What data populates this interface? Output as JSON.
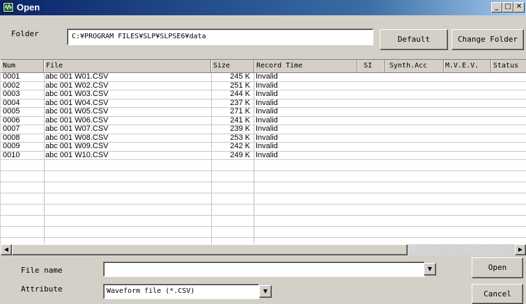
{
  "window": {
    "title": "Open",
    "minimize_label": "_",
    "maximize_label": "□",
    "close_label": "✕"
  },
  "folder": {
    "label": "Folder",
    "path": "C:¥PROGRAM FILES¥SLP¥SLPSE6¥data",
    "default_label": "Default",
    "change_folder_label": "Change Folder"
  },
  "table": {
    "columns": [
      "Num",
      "File",
      "Size",
      "Record Time",
      "SI",
      "Synth.Acc",
      "M.V.E.V.",
      "Status"
    ],
    "rows": [
      {
        "num": "0001",
        "file": "abc 001  W01.CSV",
        "size": "245 K",
        "record_time": "Invalid"
      },
      {
        "num": "0002",
        "file": "abc 001  W02.CSV",
        "size": "251 K",
        "record_time": "Invalid"
      },
      {
        "num": "0003",
        "file": "abc 001  W03.CSV",
        "size": "244 K",
        "record_time": "Invalid"
      },
      {
        "num": "0004",
        "file": "abc 001  W04.CSV",
        "size": "237 K",
        "record_time": "Invalid"
      },
      {
        "num": "0005",
        "file": "abc 001  W05.CSV",
        "size": "271 K",
        "record_time": "Invalid"
      },
      {
        "num": "0006",
        "file": "abc 001  W06.CSV",
        "size": "241 K",
        "record_time": "Invalid"
      },
      {
        "num": "0007",
        "file": "abc 001  W07.CSV",
        "size": "239 K",
        "record_time": "Invalid"
      },
      {
        "num": "0008",
        "file": "abc 001  W08.CSV",
        "size": "253 K",
        "record_time": "Invalid"
      },
      {
        "num": "0009",
        "file": "abc 001  W09.CSV",
        "size": "242 K",
        "record_time": "Invalid"
      },
      {
        "num": "0010",
        "file": "abc 001  W10.CSV",
        "size": "249 K",
        "record_time": "Invalid"
      }
    ]
  },
  "bottom": {
    "file_name_label": "File name",
    "file_name_value": "",
    "attribute_label": "Attribute",
    "attribute_value": "Waveform file (*.CSV)",
    "open_label": "Open",
    "cancel_label": "Cancel"
  },
  "icons": {
    "app": "waveform-icon",
    "dropdown": "chevron-down-icon",
    "scroll_left": "arrow-left-icon",
    "scroll_right": "arrow-right-icon"
  }
}
